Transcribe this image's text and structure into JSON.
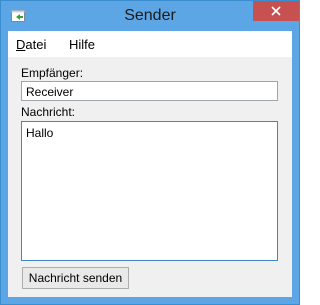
{
  "window": {
    "title": "Sender",
    "icon": "app-window-icon",
    "close_glyph": "✕"
  },
  "menu": {
    "items": [
      {
        "label": "Datei",
        "mnemonic": "D",
        "rest": "atei"
      },
      {
        "label": "Hilfe",
        "mnemonic": "",
        "rest": "Hilfe"
      }
    ]
  },
  "form": {
    "recipient_label": "Empfänger:",
    "recipient_value": "Receiver",
    "message_label": "Nachricht:",
    "message_value": "Hallo",
    "send_button": "Nachricht senden"
  }
}
